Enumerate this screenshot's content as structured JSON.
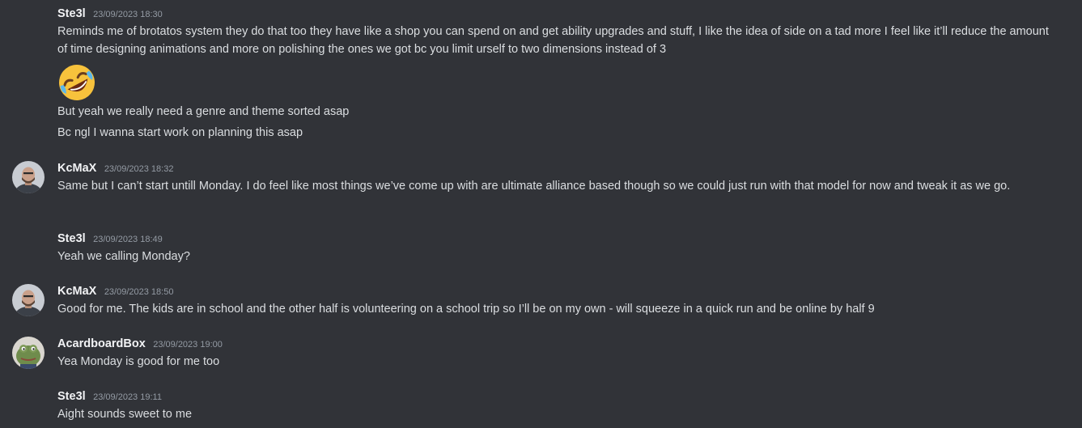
{
  "messages": [
    {
      "username": "Ste3l",
      "timestamp": "23/09/2023 18:30",
      "text": "Reminds me of brotatos system they do that too they have like a shop you can spend on and get ability upgrades and stuff, I like the idea of side on a tad more I feel  like it’ll reduce the amount of time designing animations and more on polishing the ones we got bc you limit urself to two dimensions instead of 3",
      "emoji": "rolling-on-floor-laughing-emoji",
      "followups": [
        "But yeah we really need a genre and theme sorted asap",
        "Bc ngl I wanna start work on planning this asap"
      ]
    },
    {
      "username": "KcMaX",
      "timestamp": "23/09/2023 18:32",
      "text": "Same but I can’t start untill Monday. I do feel like most things we’ve come up with are ultimate alliance based though so we could just run with that model for now and tweak it as we go."
    },
    {
      "username": "Ste3l",
      "timestamp": "23/09/2023 18:49",
      "text": "Yeah we calling Monday?"
    },
    {
      "username": "KcMaX",
      "timestamp": "23/09/2023 18:50",
      "text": "Good for me. The kids are in school and the other half is volunteering on a school trip so I’ll be on my own - will squeeze in a quick run and be online by half 9"
    },
    {
      "username": "AcardboardBox",
      "timestamp": "23/09/2023 19:00",
      "text": "Yea Monday is good for me too"
    },
    {
      "username": "Ste3l",
      "timestamp": "23/09/2023 19:11",
      "text": "Aight sounds sweet to me"
    }
  ],
  "icons": {
    "kcmax_avatar": "avatar",
    "acardboardbox_avatar": "frog-avatar"
  },
  "colors": {
    "background": "#313338",
    "username": "#f2f3f5",
    "message_text": "#dbdee1",
    "timestamp": "#949ba4"
  }
}
